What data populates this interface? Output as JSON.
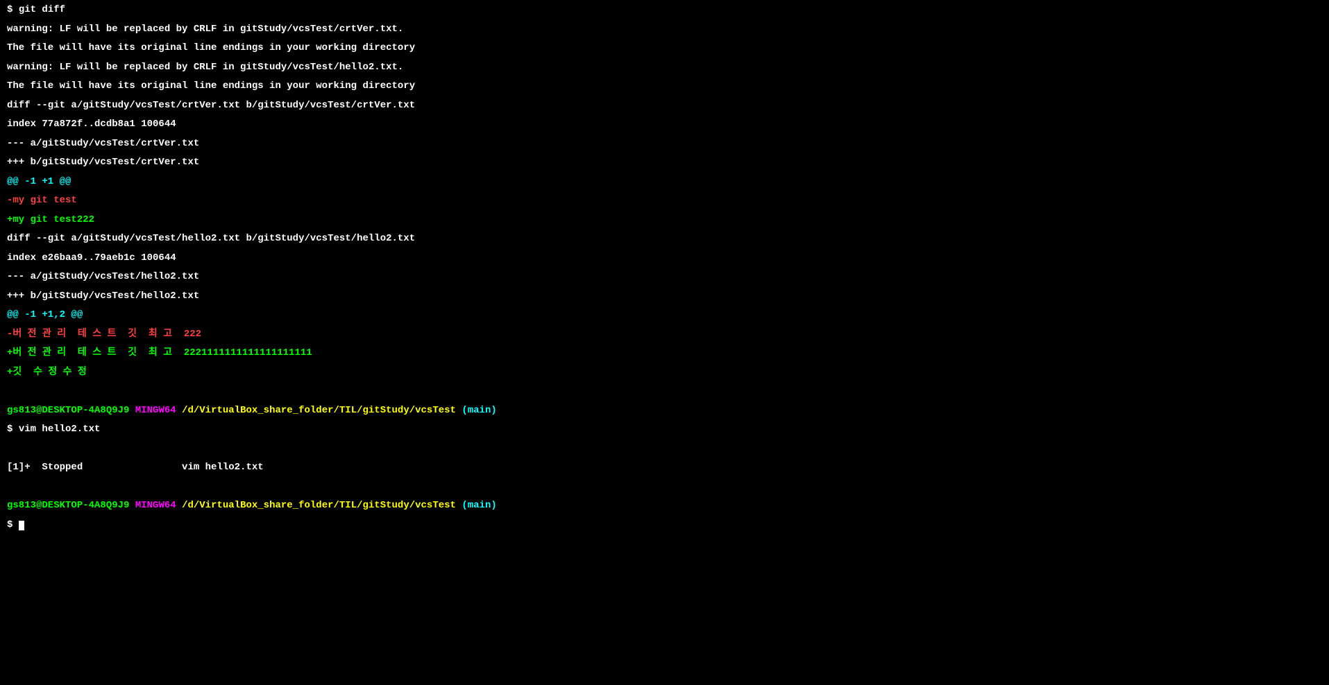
{
  "prompt1": {
    "user_host": "gs813@DESKTOP-4A8Q9J9",
    "env": "MINGW64",
    "path": "/d/VirtualBox_share_folder/TIL/gitStudy/vcsTest",
    "branch": "(main)",
    "dollar": "$ "
  },
  "cmd1": "git diff",
  "output": {
    "warn1": "warning: LF will be replaced by CRLF in gitStudy/vcsTest/crtVer.txt.",
    "warn2": "The file will have its original line endings in your working directory",
    "warn3": "warning: LF will be replaced by CRLF in gitStudy/vcsTest/hello2.txt.",
    "warn4": "The file will have its original line endings in your working directory",
    "diff1_header": "diff --git a/gitStudy/vcsTest/crtVer.txt b/gitStudy/vcsTest/crtVer.txt",
    "diff1_index": "index 77a872f..dcdb8a1 100644",
    "diff1_from": "--- a/gitStudy/vcsTest/crtVer.txt",
    "diff1_to": "+++ b/gitStudy/vcsTest/crtVer.txt",
    "diff1_hunk": "@@ -1 +1 @@",
    "diff1_minus": "-my git test",
    "diff1_plus": "+my git test222",
    "diff2_header": "diff --git a/gitStudy/vcsTest/hello2.txt b/gitStudy/vcsTest/hello2.txt",
    "diff2_index": "index e26baa9..79aeb1c 100644",
    "diff2_from": "--- a/gitStudy/vcsTest/hello2.txt",
    "diff2_to": "+++ b/gitStudy/vcsTest/hello2.txt",
    "diff2_hunk": "@@ -1 +1,2 @@",
    "diff2_minus": "-버 전 관 리  테 스 트  깃  최 고  222",
    "diff2_plus1": "+버 전 관 리  테 스 트  깃  최 고  2221111111111111111111",
    "diff2_plus2": "+깃  수 정 수 정"
  },
  "blank": " ",
  "cmd2": "vim hello2.txt",
  "stopped": "[1]+  Stopped                 vim hello2.txt",
  "cursor_dollar": "$ "
}
